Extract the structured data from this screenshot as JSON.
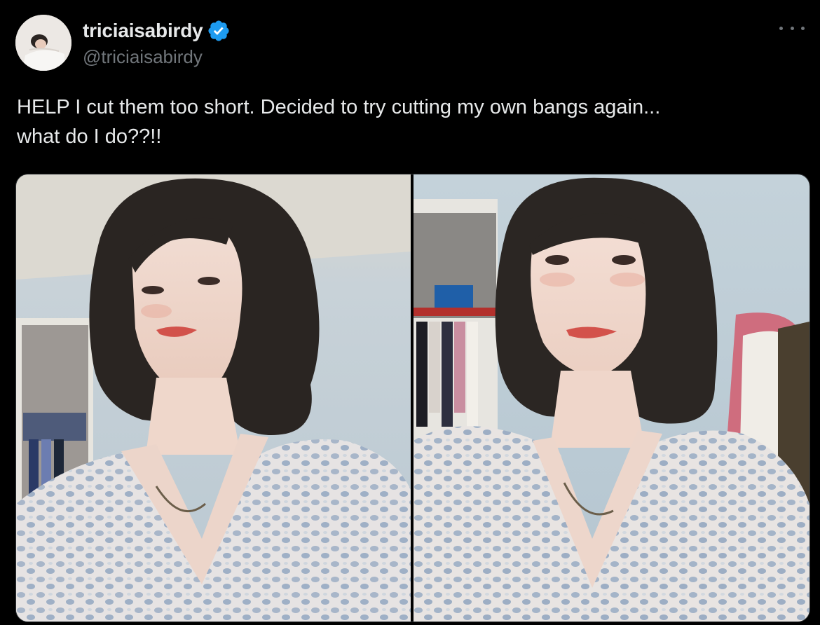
{
  "post": {
    "author": {
      "display_name": "triciaisabirdy",
      "handle": "@triciaisabirdy",
      "verified": true,
      "avatar_icon": "user-avatar"
    },
    "more_icon": "ellipsis-icon",
    "text": "HELP I cut them too short. Decided to try cutting my own bangs again...\nwhat do I do??!!",
    "media": [
      {
        "kind": "photo",
        "icon": "selfie-photo-left"
      },
      {
        "kind": "photo",
        "icon": "selfie-photo-right"
      }
    ]
  },
  "colors": {
    "background": "#000000",
    "primary_text": "#e7e9ea",
    "secondary_text": "#71767b",
    "verified_badge": "#1d9bf0",
    "border": "#2f3336"
  }
}
